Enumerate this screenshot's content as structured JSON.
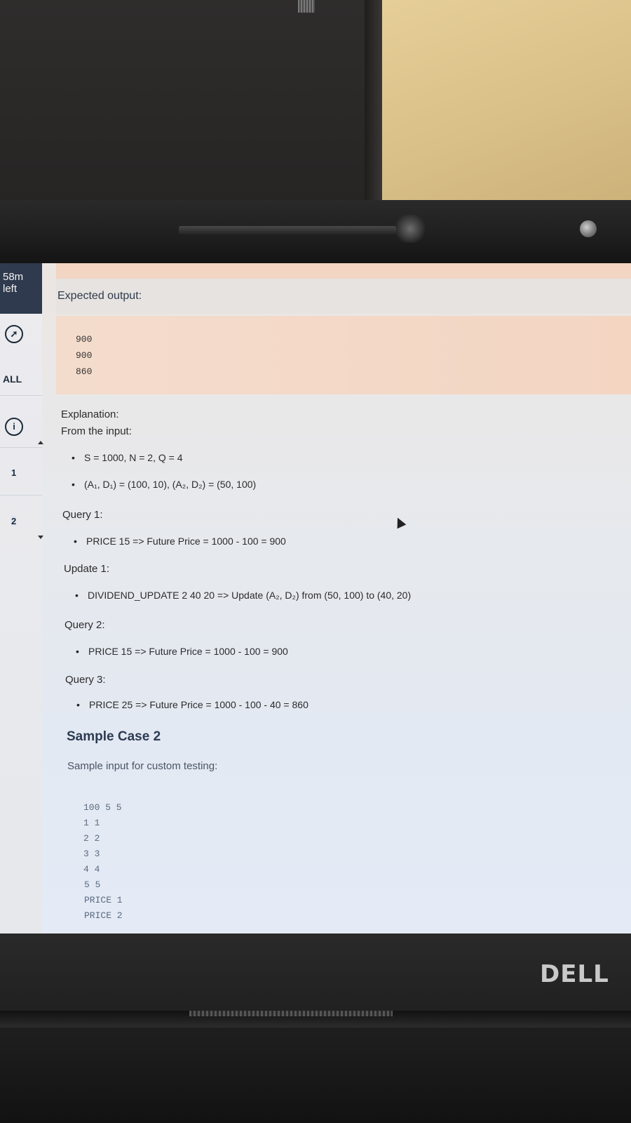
{
  "sidebar": {
    "timer_value": "58m",
    "timer_label": "left",
    "all_label": "ALL",
    "question_numbers": [
      "1",
      "2"
    ]
  },
  "output": {
    "label": "Expected output:",
    "lines": [
      "900",
      "900",
      "860"
    ]
  },
  "explanation": {
    "title": "Explanation:",
    "intro": "From the input:",
    "bullets": [
      "S = 1000, N = 2, Q = 4",
      "(A₁, D₁) = (100, 10), (A₂, D₂) = (50, 100)"
    ],
    "steps": [
      {
        "label": "Query 1:",
        "text": "PRICE 15 => Future Price = 1000 - 100 = 900"
      },
      {
        "label": "Update 1:",
        "text": "DIVIDEND_UPDATE 2 40 20 => Update (A₂, D₂) from (50, 100) to (40, 20)"
      },
      {
        "label": "Query 2:",
        "text": "PRICE 15 => Future Price = 1000 - 100 = 900"
      },
      {
        "label": "Query 3:",
        "text": "PRICE 25 => Future Price = 1000 - 100 - 40 = 860"
      }
    ]
  },
  "sample2": {
    "heading": "Sample Case 2",
    "subtitle": "Sample input for custom testing:",
    "input_lines": [
      "100 5 5",
      "1 1",
      "2 2",
      "3 3",
      "4 4",
      "5 5",
      "PRICE 1",
      "PRICE 2"
    ]
  },
  "device": {
    "brand": "DELL"
  },
  "colors": {
    "sidebar_timer_bg": "#2f3a4e",
    "output_box_bg": "#f3d5c2",
    "heading_color": "#2c3b52"
  }
}
